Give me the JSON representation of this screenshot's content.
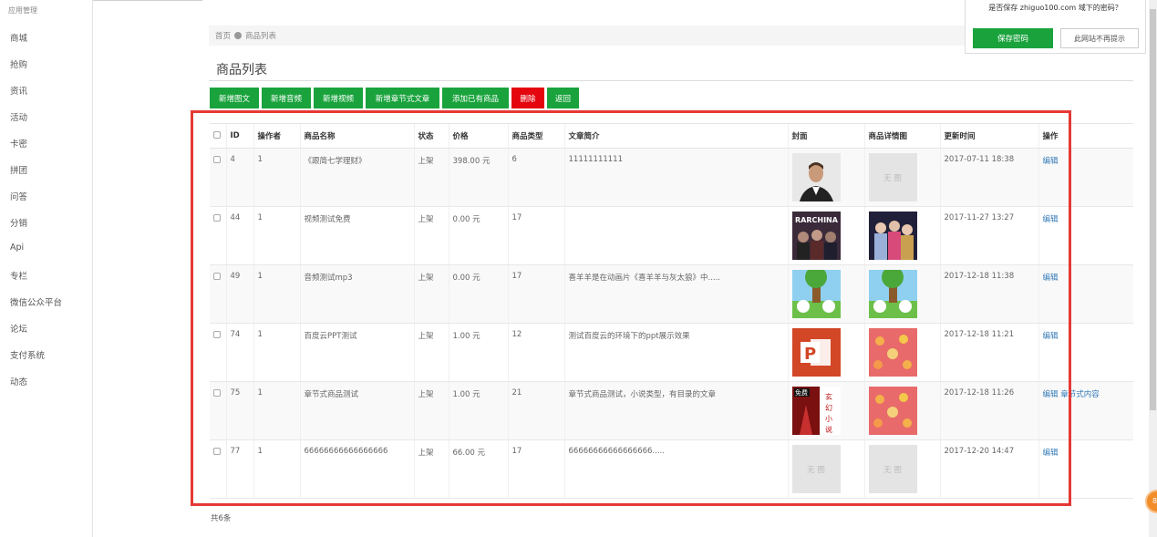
{
  "sidebar": {
    "header": "应用管理",
    "items": [
      "商城",
      "抢购",
      "资讯",
      "活动",
      "卡密",
      "拼团",
      "问答",
      "分销",
      "Api",
      "专栏",
      "微信公众平台",
      "论坛",
      "支付系统",
      "动态"
    ]
  },
  "breadcrumb": {
    "home": "首页",
    "current": "商品列表"
  },
  "page_title": "商品列表",
  "toolbar": {
    "buttons": [
      "新增图文",
      "新增音频",
      "新增视频",
      "新增章节式文章",
      "添加已有商品",
      "删除",
      "返回"
    ]
  },
  "table": {
    "headers": [
      "ID",
      "操作者",
      "商品名称",
      "状态",
      "价格",
      "商品类型",
      "文章简介",
      "封面",
      "商品详情图",
      "更新时间",
      "操作"
    ],
    "no_image_text": "无 图",
    "rows": [
      {
        "id": "4",
        "operator": "1",
        "name": "《跟简七学理财》",
        "status": "上架",
        "price": "398.00 元",
        "type": "6",
        "intro": "11111111111",
        "updated": "2017-07-11 18:38",
        "action": "编辑",
        "action2": ""
      },
      {
        "id": "44",
        "operator": "1",
        "name": "视频测试免费",
        "status": "上架",
        "price": "0.00 元",
        "type": "17",
        "intro": "",
        "updated": "2017-11-27 13:27",
        "action": "编辑",
        "action2": ""
      },
      {
        "id": "49",
        "operator": "1",
        "name": "音频测试mp3",
        "status": "上架",
        "price": "0.00 元",
        "type": "17",
        "intro": "喜羊羊是在动画片《喜羊羊与灰太狼》中.....",
        "updated": "2017-12-18 11:38",
        "action": "编辑",
        "action2": ""
      },
      {
        "id": "74",
        "operator": "1",
        "name": "百度云PPT测试",
        "status": "上架",
        "price": "1.00 元",
        "type": "12",
        "intro": "测试百度云的环境下的ppt展示效果",
        "updated": "2017-12-18 11:21",
        "action": "编辑",
        "action2": ""
      },
      {
        "id": "75",
        "operator": "1",
        "name": "章节式商品测试",
        "status": "上架",
        "price": "1.00 元",
        "type": "21",
        "intro": "章节式商品测试，小说类型，有目录的文章",
        "updated": "2017-12-18 11:26",
        "action": "编辑",
        "action2": "章节式内容"
      },
      {
        "id": "77",
        "operator": "1",
        "name": "66666666666666666",
        "status": "上架",
        "price": "66.00 元",
        "type": "17",
        "intro": "66666666666666666.....",
        "updated": "2017-12-20 14:47",
        "action": "编辑",
        "action2": ""
      }
    ]
  },
  "covers": {
    "rarchina_text": "RARCHINA",
    "novel_text": "免费",
    "novel_chars": "玄幻小说"
  },
  "total": "共6条",
  "password_popup": {
    "message": "是否保存 zhiguo100.com 域下的密码？",
    "save": "保存密码",
    "never": "此网站不再提示"
  },
  "float_button": "83",
  "colors": {
    "green": "#1aa33d",
    "red": "#e4050f",
    "highlight": "#e53935",
    "link": "#337ab7"
  }
}
